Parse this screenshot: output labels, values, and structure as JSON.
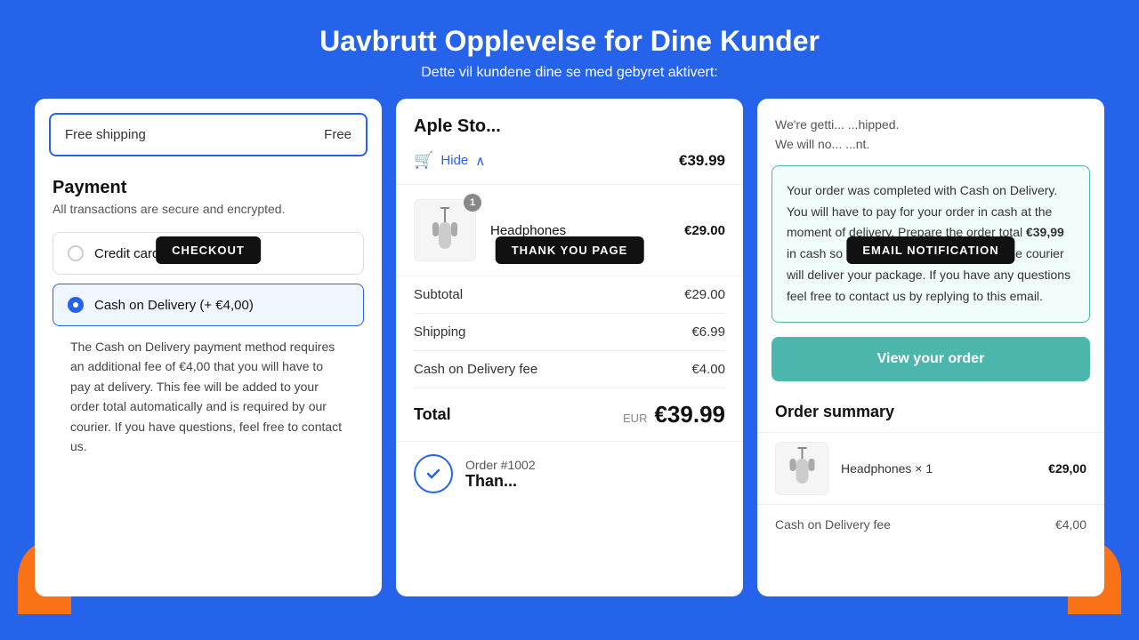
{
  "page": {
    "title": "Uavbrutt Opplevelse for Dine Kunder",
    "subtitle": "Dette vil kundene dine se med gebyret aktivert:",
    "background_color": "#2563EB"
  },
  "checkout_panel": {
    "badge": "CHECKOUT",
    "free_shipping_label": "Free shipping",
    "free_shipping_value": "Free",
    "payment_title": "Payment",
    "payment_subtitle": "All transactions are secure and encrypted.",
    "options": [
      {
        "id": "credit_card",
        "label": "Credit card",
        "selected": false
      },
      {
        "id": "cod",
        "label": "Cash on Delivery (+ €4,00)",
        "selected": true
      }
    ],
    "cod_description": "The Cash on Delivery payment method requires an additional fee of €4,00 that you will have to pay at delivery. This fee will be added to your order total automatically and is required by our courier. If you have questions, feel free to contact us."
  },
  "thankyou_panel": {
    "badge": "THANK YOU PAGE",
    "store_name": "Aple Sto...",
    "hide_label": "Hide",
    "cart_total": "€39.99",
    "product": {
      "name": "Headphones",
      "price": "€29.00",
      "qty": 1
    },
    "subtotal_label": "Subtotal",
    "subtotal_value": "€29.00",
    "shipping_label": "Shipping",
    "shipping_value": "€6.99",
    "cod_fee_label": "Cash on Delivery fee",
    "cod_fee_value": "€4.00",
    "total_label": "Total",
    "total_currency": "EUR",
    "total_value": "€39.99",
    "order_number": "Order #1002",
    "order_title": "Than..."
  },
  "email_panel": {
    "badge": "EMAIL NOTIFICATION",
    "intro_text": "We're getti... ...hipped. We will no... ...nt.",
    "notice_text_before": "Your order was completed with Cash on Delivery. You will have to pay for your order in cash at the moment of delivery. Prepare the order total ",
    "notice_amount": "€39,99",
    "notice_text_after": " in cash so that you'll be ready for when the courier will deliver your package. If you have any questions feel free to contact us by replying to this email.",
    "view_order_btn": "View your order",
    "order_summary_title": "Order summary",
    "product": {
      "name": "Headphones × 1",
      "price": "€29,00"
    },
    "cod_fee_label": "Cash on Delivery fee",
    "cod_fee_value": "€4,00"
  }
}
